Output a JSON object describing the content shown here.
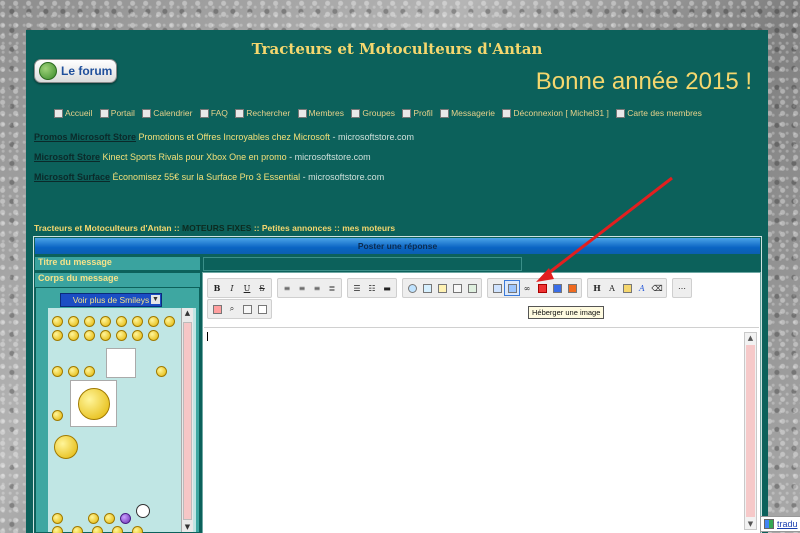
{
  "site": {
    "title": "Tracteurs et Motoculteurs d'Antan",
    "logo_label": "Le forum",
    "banner": "Bonne année 2015 !"
  },
  "nav": {
    "items": [
      {
        "label": "Accueil"
      },
      {
        "label": "Portail"
      },
      {
        "label": "Calendrier"
      },
      {
        "label": "FAQ"
      },
      {
        "label": "Rechercher"
      },
      {
        "label": "Membres"
      },
      {
        "label": "Groupes"
      },
      {
        "label": "Profil"
      },
      {
        "label": "Messagerie"
      },
      {
        "label": "Déconnexion [ Michel31 ]"
      },
      {
        "label": "Carte des membres"
      }
    ]
  },
  "ads": [
    {
      "title": "Promos Microsoft Store",
      "desc": "Promotions et Offres Incroyables chez Microsoft",
      "source": "microsoftstore.com"
    },
    {
      "title": "Microsoft Store",
      "desc": "Kinect Sports Rivals pour Xbox One en promo",
      "source": "microsoftstore.com"
    },
    {
      "title": "Microsoft Surface",
      "desc": "Économisez 55€ sur la Surface Pro 3 Essential",
      "source": "microsoftstore.com"
    }
  ],
  "breadcrumb": {
    "root": "Tracteurs et Motoculteurs d'Antan",
    "sep": "::",
    "section": "MOTEURS FIXES",
    "subsection": "Petites annonces",
    "topic": "mes moteurs"
  },
  "form": {
    "header": "Poster une réponse",
    "title_label": "Titre du message",
    "body_label": "Corps du message",
    "smiley_select": "Voir plus de Smileys",
    "tooltip": "Héberger une image"
  },
  "translate": {
    "label": "tradu"
  },
  "colors": {
    "panel_bg": "#0c615b",
    "accent_text": "#f5d76e",
    "header_blue": "#0a64c3",
    "arrow_red": "#e21f1f"
  }
}
